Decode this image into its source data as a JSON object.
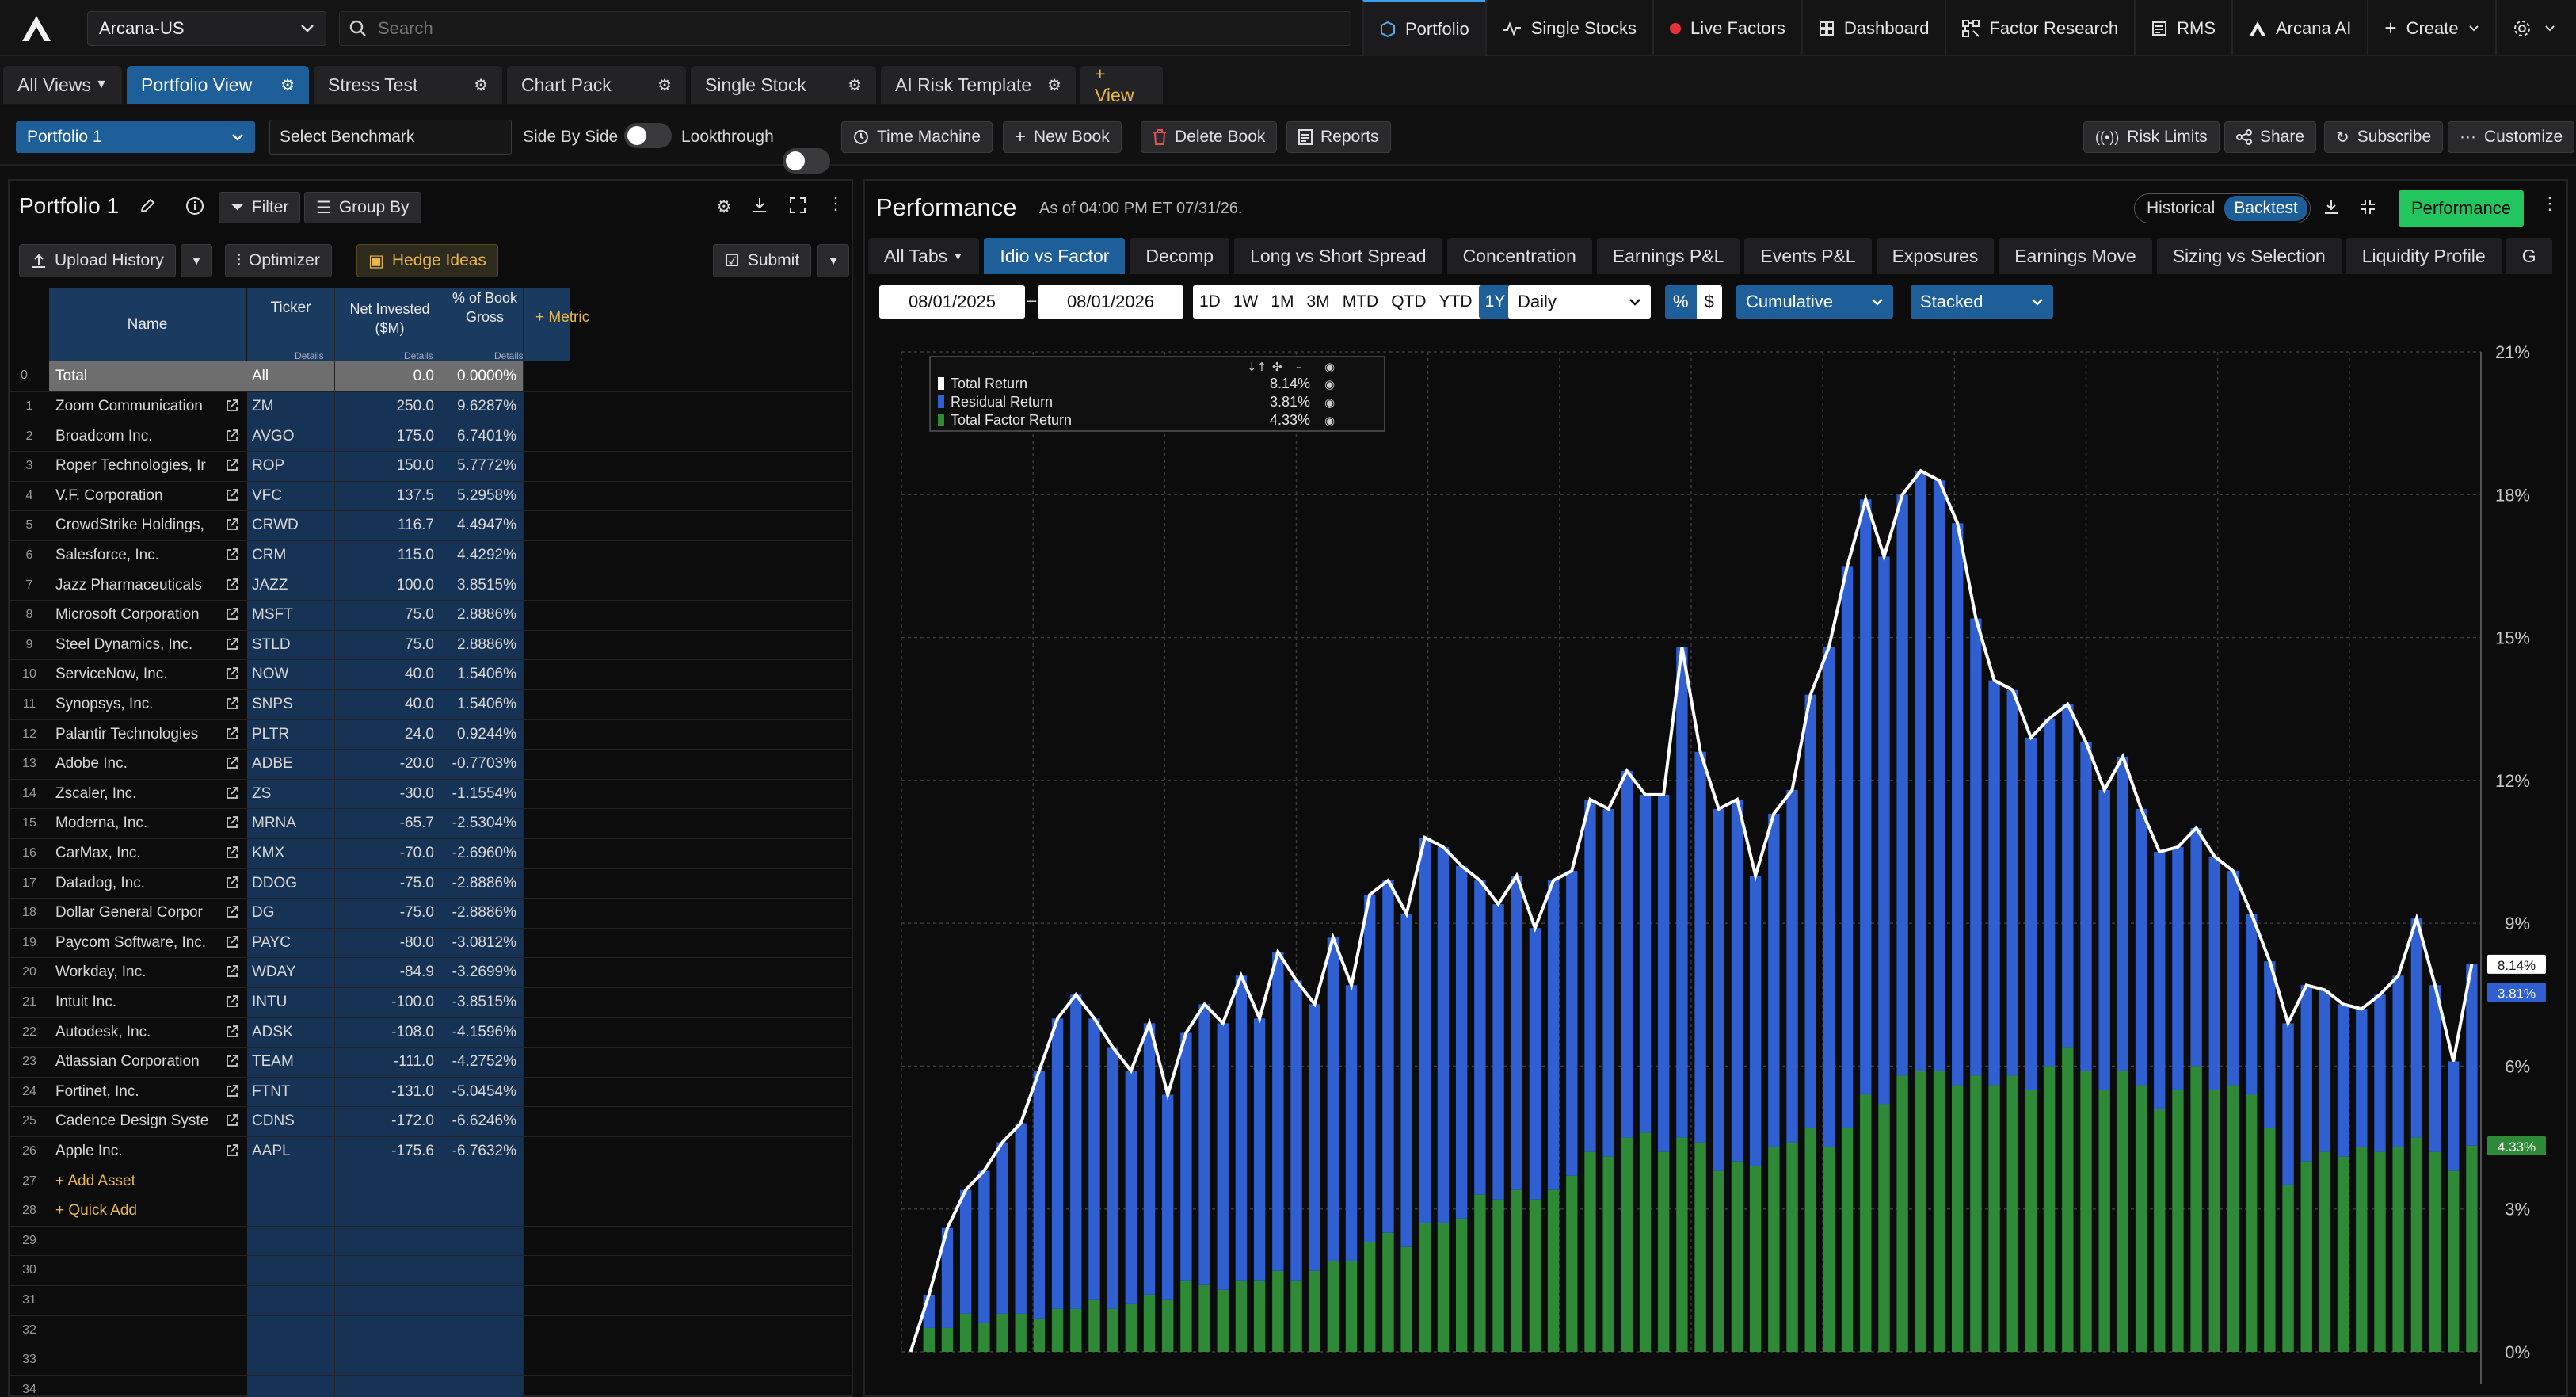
{
  "nav": {
    "account": "Arcana-US",
    "search_placeholder": "Search",
    "items": [
      "Portfolio",
      "Single Stocks",
      "Live Factors",
      "Dashboard",
      "Factor Research",
      "RMS",
      "Arcana AI",
      "Create"
    ]
  },
  "view_tabs": {
    "all_views": "All Views",
    "tabs": [
      "Portfolio View",
      "Stress Test",
      "Chart Pack",
      "Single Stock",
      "AI Risk Template"
    ],
    "add_view": "+ View"
  },
  "toolbar": {
    "portfolio_select": "Portfolio 1",
    "benchmark_placeholder": "Select Benchmark",
    "side_by_side": "Side By Side",
    "lookthrough": "Lookthrough",
    "time_machine": "Time Machine",
    "new_book": "New Book",
    "delete_book": "Delete Book",
    "reports": "Reports",
    "risk_limits": "Risk Limits",
    "share": "Share",
    "subscribe": "Subscribe",
    "customize": "Customize"
  },
  "left": {
    "title": "Portfolio 1",
    "filter": "Filter",
    "group_by": "Group By",
    "upload_history": "Upload History",
    "optimizer": "Optimizer",
    "hedge_ideas": "Hedge Ideas",
    "submit": "Submit",
    "columns": {
      "name": "Name",
      "ticker": "Ticker",
      "net_invested": "Net Invested ($M)",
      "pct_gross": "% of Book Gross",
      "details": "Details",
      "add_metric": "+ Metric"
    },
    "total_row": {
      "num": "0",
      "name": "Total",
      "ticker": "All",
      "net": "0.0",
      "pct": "0.0000%"
    },
    "rows": [
      {
        "name": "Zoom Communication",
        "ticker": "ZM",
        "net": "250.0",
        "pct": "9.6287%"
      },
      {
        "name": "Broadcom Inc.",
        "ticker": "AVGO",
        "net": "175.0",
        "pct": "6.7401%"
      },
      {
        "name": "Roper Technologies, Ir",
        "ticker": "ROP",
        "net": "150.0",
        "pct": "5.7772%"
      },
      {
        "name": "V.F. Corporation",
        "ticker": "VFC",
        "net": "137.5",
        "pct": "5.2958%"
      },
      {
        "name": "CrowdStrike Holdings,",
        "ticker": "CRWD",
        "net": "116.7",
        "pct": "4.4947%"
      },
      {
        "name": "Salesforce, Inc.",
        "ticker": "CRM",
        "net": "115.0",
        "pct": "4.4292%"
      },
      {
        "name": "Jazz Pharmaceuticals",
        "ticker": "JAZZ",
        "net": "100.0",
        "pct": "3.8515%"
      },
      {
        "name": "Microsoft Corporation",
        "ticker": "MSFT",
        "net": "75.0",
        "pct": "2.8886%"
      },
      {
        "name": "Steel Dynamics, Inc.",
        "ticker": "STLD",
        "net": "75.0",
        "pct": "2.8886%"
      },
      {
        "name": "ServiceNow, Inc.",
        "ticker": "NOW",
        "net": "40.0",
        "pct": "1.5406%"
      },
      {
        "name": "Synopsys, Inc.",
        "ticker": "SNPS",
        "net": "40.0",
        "pct": "1.5406%"
      },
      {
        "name": "Palantir Technologies",
        "ticker": "PLTR",
        "net": "24.0",
        "pct": "0.9244%"
      },
      {
        "name": "Adobe Inc.",
        "ticker": "ADBE",
        "net": "-20.0",
        "pct": "-0.7703%"
      },
      {
        "name": "Zscaler, Inc.",
        "ticker": "ZS",
        "net": "-30.0",
        "pct": "-1.1554%"
      },
      {
        "name": "Moderna, Inc.",
        "ticker": "MRNA",
        "net": "-65.7",
        "pct": "-2.5304%"
      },
      {
        "name": "CarMax, Inc.",
        "ticker": "KMX",
        "net": "-70.0",
        "pct": "-2.6960%"
      },
      {
        "name": "Datadog, Inc.",
        "ticker": "DDOG",
        "net": "-75.0",
        "pct": "-2.8886%"
      },
      {
        "name": "Dollar General Corpor",
        "ticker": "DG",
        "net": "-75.0",
        "pct": "-2.8886%"
      },
      {
        "name": "Paycom Software, Inc.",
        "ticker": "PAYC",
        "net": "-80.0",
        "pct": "-3.0812%"
      },
      {
        "name": "Workday, Inc.",
        "ticker": "WDAY",
        "net": "-84.9",
        "pct": "-3.2699%"
      },
      {
        "name": "Intuit Inc.",
        "ticker": "INTU",
        "net": "-100.0",
        "pct": "-3.8515%"
      },
      {
        "name": "Autodesk, Inc.",
        "ticker": "ADSK",
        "net": "-108.0",
        "pct": "-4.1596%"
      },
      {
        "name": "Atlassian Corporation",
        "ticker": "TEAM",
        "net": "-111.0",
        "pct": "-4.2752%"
      },
      {
        "name": "Fortinet, Inc.",
        "ticker": "FTNT",
        "net": "-131.0",
        "pct": "-5.0454%"
      },
      {
        "name": "Cadence Design Syste",
        "ticker": "CDNS",
        "net": "-172.0",
        "pct": "-6.6246%"
      },
      {
        "name": "Apple Inc.",
        "ticker": "AAPL",
        "net": "-175.6",
        "pct": "-6.7632%"
      }
    ],
    "add_asset": "+ Add Asset",
    "quick_add": "+ Quick Add",
    "empty_row_numbers": [
      "29",
      "30",
      "31",
      "32",
      "33",
      "34"
    ]
  },
  "right": {
    "title": "Performance",
    "as_of": "As of 04:00 PM ET 07/31/26.",
    "historical": "Historical",
    "backtest": "Backtest",
    "performance_btn": "Performance",
    "analysis_tabs": [
      "All Tabs",
      "Idio vs Factor",
      "Decomp",
      "Long vs Short Spread",
      "Concentration",
      "Earnings P&L",
      "Events P&L",
      "Exposures",
      "Earnings Move",
      "Sizing vs Selection",
      "Liquidity Profile",
      "G"
    ],
    "date_from": "08/01/2025",
    "date_sep": "–",
    "date_to": "08/01/2026",
    "ranges": [
      "1D",
      "1W",
      "1M",
      "3M",
      "MTD",
      "QTD",
      "YTD",
      "1Y"
    ],
    "frequency": "Daily",
    "unit_pct": "%",
    "unit_usd": "$",
    "mode": "Cumulative",
    "stacking": "Stacked"
  },
  "chart_data": {
    "type": "area",
    "stacked": true,
    "ylim": [
      0,
      21
    ],
    "y_ticks": [
      "0%",
      "3%",
      "6%",
      "9%",
      "12%",
      "15%",
      "18%",
      "21%"
    ],
    "grid": true,
    "legend_position": "top-left",
    "colors": {
      "total": "#ffffff",
      "residual": "#2f5fd0",
      "factor": "#2e8a36"
    },
    "series": [
      {
        "name": "Total Return",
        "last": "8.14%",
        "values": [
          0.0,
          1.2,
          2.6,
          3.4,
          3.8,
          4.4,
          4.8,
          5.9,
          7.0,
          7.5,
          7.0,
          6.4,
          5.9,
          6.9,
          5.4,
          6.7,
          7.3,
          6.9,
          7.9,
          7.0,
          8.4,
          7.8,
          7.3,
          8.7,
          7.7,
          9.6,
          9.9,
          9.2,
          10.8,
          10.6,
          10.2,
          9.9,
          9.4,
          10.0,
          8.9,
          9.9,
          10.1,
          11.6,
          11.4,
          12.2,
          11.7,
          11.7,
          14.8,
          12.6,
          11.4,
          11.6,
          10.0,
          11.3,
          11.8,
          13.8,
          14.8,
          16.5,
          17.9,
          16.7,
          18.0,
          18.5,
          18.3,
          17.4,
          15.4,
          14.1,
          13.9,
          12.9,
          13.3,
          13.6,
          12.8,
          11.8,
          12.5,
          11.4,
          10.5,
          10.6,
          11.0,
          10.4,
          10.1,
          9.2,
          8.2,
          6.9,
          7.7,
          7.6,
          7.3,
          7.2,
          7.5,
          7.9,
          9.1,
          7.7,
          6.1,
          8.14
        ]
      },
      {
        "name": "Residual Return",
        "last": "3.81%",
        "values": [
          0.0,
          0.7,
          2.1,
          2.6,
          3.2,
          3.6,
          4.0,
          5.2,
          6.1,
          6.6,
          5.9,
          5.5,
          4.9,
          5.7,
          4.3,
          5.2,
          5.9,
          5.6,
          6.4,
          5.5,
          6.7,
          6.3,
          5.6,
          6.8,
          5.8,
          7.3,
          7.4,
          7.0,
          8.1,
          7.9,
          7.4,
          6.6,
          6.2,
          6.6,
          5.7,
          6.5,
          6.4,
          7.4,
          7.3,
          7.7,
          7.1,
          7.5,
          10.3,
          8.2,
          7.6,
          7.6,
          6.1,
          7.0,
          7.4,
          9.1,
          10.5,
          11.8,
          12.5,
          11.5,
          12.2,
          12.6,
          12.4,
          11.8,
          9.6,
          8.5,
          8.1,
          7.4,
          7.3,
          7.2,
          6.9,
          6.3,
          6.6,
          5.8,
          5.4,
          5.1,
          5.0,
          4.9,
          4.5,
          3.8,
          3.5,
          3.4,
          3.7,
          3.4,
          3.2,
          2.9,
          3.3,
          3.6,
          4.6,
          3.5,
          2.3,
          3.81
        ]
      },
      {
        "name": "Total Factor Return",
        "last": "4.33%",
        "values": [
          0.0,
          0.5,
          0.5,
          0.8,
          0.6,
          0.8,
          0.8,
          0.7,
          0.9,
          0.9,
          1.1,
          0.9,
          1.0,
          1.2,
          1.1,
          1.5,
          1.4,
          1.3,
          1.5,
          1.5,
          1.7,
          1.5,
          1.7,
          1.9,
          1.9,
          2.3,
          2.5,
          2.2,
          2.7,
          2.7,
          2.8,
          3.3,
          3.2,
          3.4,
          3.2,
          3.4,
          3.7,
          4.2,
          4.1,
          4.5,
          4.6,
          4.2,
          4.5,
          4.4,
          3.8,
          4.0,
          3.9,
          4.3,
          4.4,
          4.7,
          4.3,
          4.7,
          5.4,
          5.2,
          5.8,
          5.9,
          5.9,
          5.6,
          5.8,
          5.6,
          5.8,
          5.5,
          6.0,
          6.4,
          5.9,
          5.5,
          5.9,
          5.6,
          5.1,
          5.5,
          6.0,
          5.5,
          5.6,
          5.4,
          4.7,
          3.5,
          4.0,
          4.2,
          4.1,
          4.3,
          4.2,
          4.3,
          4.5,
          4.2,
          3.8,
          4.33
        ]
      }
    ]
  }
}
